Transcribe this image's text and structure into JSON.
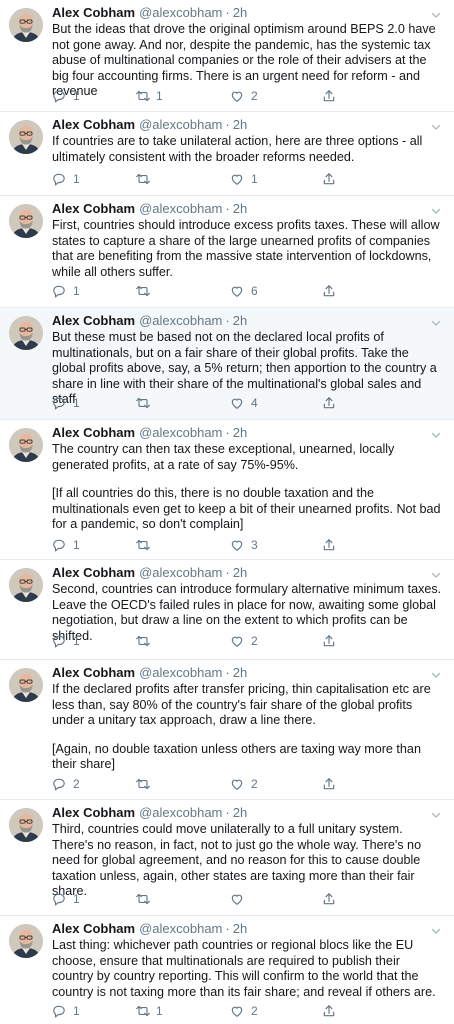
{
  "author": {
    "name": "Alex Cobham",
    "handle": "@alexcobham",
    "separator": "·",
    "time": "2h"
  },
  "icons": {
    "reply": "reply-icon",
    "retweet": "retweet-icon",
    "like": "heart-icon",
    "share": "share-icon",
    "menu": "chevron-down-icon",
    "avatar": "avatar-photo"
  },
  "colors": {
    "text": "#14171a",
    "muted": "#657786",
    "divider": "#e6ecf0",
    "highlight": "#f5f8fa"
  },
  "tweets": [
    {
      "text": "But the ideas that drove the original optimism around BEPS 2.0 have not gone away. And nor, despite the pandemic, has the systemic tax abuse of multinational companies or the role of their advisers at the big four accounting firms. There is an urgent need for reform - and revenue",
      "replies": "1",
      "retweets": "1",
      "likes": "2"
    },
    {
      "text": "If countries are to take unilateral action, here are three options - all ultimately consistent with the broader reforms needed.",
      "replies": "1",
      "retweets": "",
      "likes": "1"
    },
    {
      "text": "First, countries should introduce excess profits taxes. These will allow states to capture a share of the large unearned profits of companies that are benefiting from the massive state intervention of lockdowns, while all others suffer.",
      "replies": "1",
      "retweets": "",
      "likes": "6"
    },
    {
      "text": "But these must be based not on the declared local profits of multinationals, but on a fair share of their global profits. Take the global profits above, say, a 5% return; then apportion to the country a share in line with their share of the multinational's global sales and staff",
      "replies": "1",
      "retweets": "",
      "likes": "4"
    },
    {
      "text": "The country can then tax these exceptional, unearned, locally generated profits, at a rate of say 75%-95%.",
      "text2": "[If all countries do this, there is no double taxation and the multinationals even get to keep a bit of their unearned profits. Not bad for a pandemic, so don't complain]",
      "replies": "1",
      "retweets": "",
      "likes": "3"
    },
    {
      "text": "Second, countries can introduce formulary alternative minimum taxes. Leave the OECD's failed rules in place for now, awaiting some global negotiation, but draw a line on the extent to which profits can be shifted.",
      "replies": "1",
      "retweets": "",
      "likes": "2"
    },
    {
      "text": "If the declared profits after transfer pricing, thin capitalisation etc are less than, say 80% of the country's fair share of the global profits under a unitary tax approach, draw a line there.",
      "text2": "[Again, no double taxation unless others are taxing way more than their share]",
      "replies": "2",
      "retweets": "",
      "likes": "2"
    },
    {
      "text": "Third, countries could move unilaterally to a full unitary system. There's no reason, in fact, not to just go the whole way. There's no need for global agreement, and no reason for this to cause double taxation unless, again, other states are taxing more than their fair share.",
      "replies": "1",
      "retweets": "",
      "likes": ""
    },
    {
      "text": "Last thing: whichever path countries or regional blocs like the EU choose, ensure that multinationals are required to publish their country by country reporting. This will confirm to the world that the country is not taxing more than its fair share; and reveal if others are.",
      "replies": "1",
      "retweets": "1",
      "likes": "2"
    }
  ]
}
